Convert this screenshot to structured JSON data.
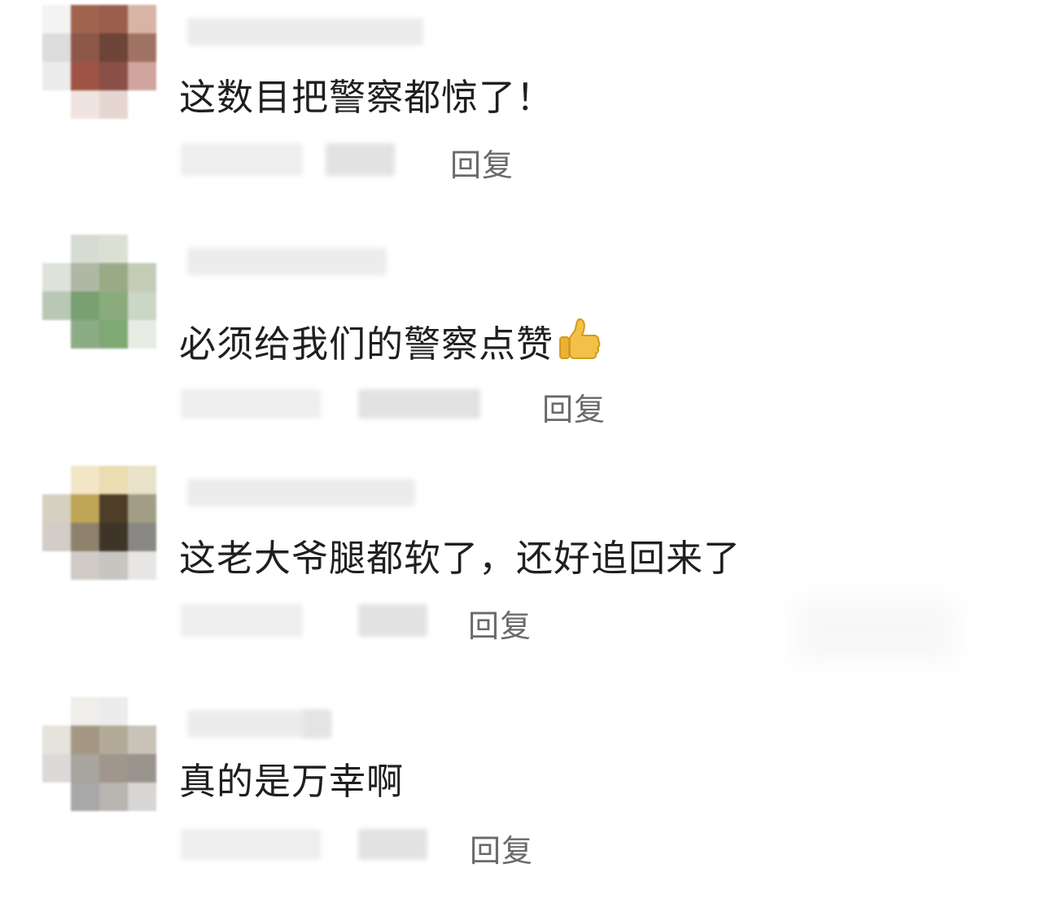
{
  "comments": [
    {
      "text": "这数目把警察都惊了！",
      "reply_label": "回复",
      "avatar_colors": [
        "#f4f4f4",
        "#a0644e",
        "#9c5e4c",
        "#d8b4a4",
        "#dcdcdc",
        "#8e5848",
        "#6c4438",
        "#a07264",
        "#ececec",
        "#9e5444",
        "#8a5048",
        "#cfa49c",
        "#ffffff",
        "#f0e4e0",
        "#e6d6d0",
        "#ffffff"
      ]
    },
    {
      "text": "必须给我们的警察点赞",
      "emoji": "thumbs-up-icon",
      "reply_label": "回复",
      "avatar_colors": [
        "#ffffff",
        "#d6dcd2",
        "#dce0d4",
        "#ffffff",
        "#dde2da",
        "#aeb8a4",
        "#9aaa86",
        "#c4ccb6",
        "#b8c8b4",
        "#78a070",
        "#8aac7c",
        "#cad6c6",
        "#ffffff",
        "#8cac86",
        "#7ea874",
        "#e6ece4"
      ]
    },
    {
      "text": "这老大爷腿都软了，还好追回来了",
      "reply_label": "回复",
      "avatar_colors": [
        "#ffffff",
        "#f2e6c6",
        "#ecdcb2",
        "#e8e2c8",
        "#d6d0c0",
        "#c0a458",
        "#4e3e28",
        "#a29e86",
        "#d2cdc6",
        "#8e826c",
        "#3e3428",
        "#8a8884",
        "#ffffff",
        "#d0cbc6",
        "#c8c4c0",
        "#e8e6e4"
      ]
    },
    {
      "text": "真的是万幸啊",
      "reply_label": "回复",
      "avatar_colors": [
        "#ffffff",
        "#f0eeea",
        "#ececec",
        "#ffffff",
        "#e6e2dc",
        "#a49884",
        "#b4aa98",
        "#c8c2b8",
        "#dcdad8",
        "#a8a49e",
        "#a0968c",
        "#9a948e",
        "#ffffff",
        "#a8a8a8",
        "#b8b4b0",
        "#d8d6d4"
      ]
    }
  ]
}
